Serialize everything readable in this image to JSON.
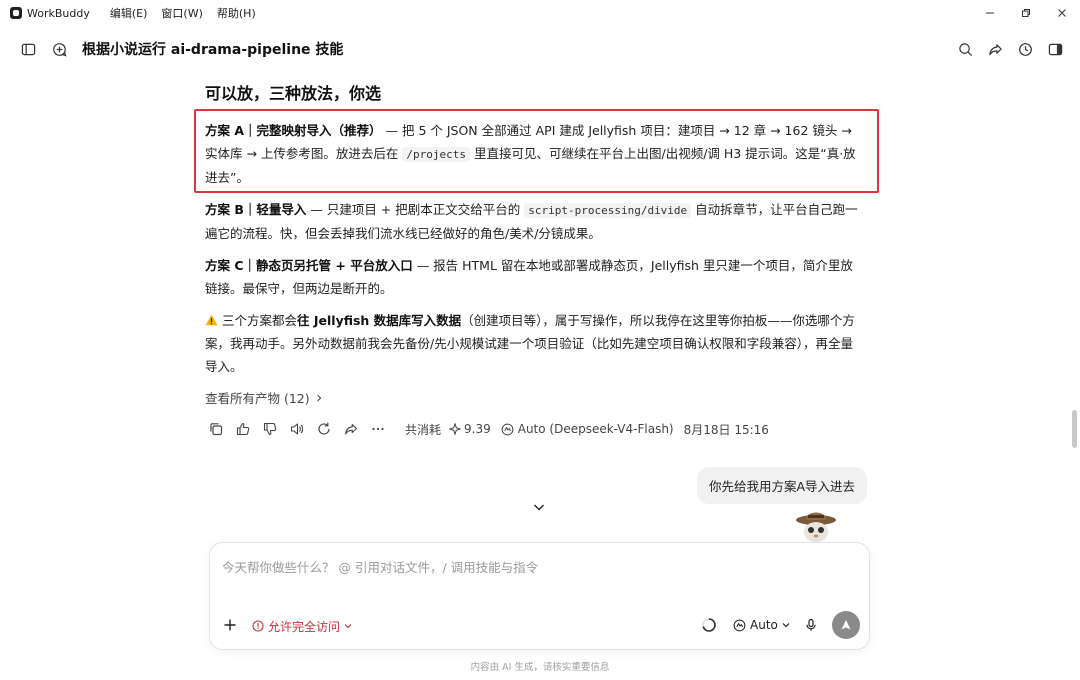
{
  "window": {
    "app_name": "WorkBuddy",
    "menus": [
      "编辑(E)",
      "窗口(W)",
      "帮助(H)"
    ]
  },
  "header": {
    "title": "根据小说运行 ai-drama-pipeline 技能"
  },
  "message": {
    "heading": "可以放，三种放法，你选",
    "option_a": {
      "label": "方案 A｜完整映射导入（推荐）",
      "text1": " — 把 5 个 JSON 全部通过 API 建成 Jellyfish 项目：建项目 → 12 章 → 162 镜头 → 实体库 → 上传参考图。放进去后在 ",
      "code": "/projects",
      "text2": " 里直接可见、可继续在平台上出图/出视频/调 H3 提示词。这是“真·放进去”。"
    },
    "option_b": {
      "label": "方案 B｜轻量导入",
      "text1": " — 只建项目 + 把剧本正文交给平台的 ",
      "code": "script-processing/divide",
      "text2": " 自动拆章节，让平台自己跑一遍它的流程。快，但会丢掉我们流水线已经做好的角色/美术/分镜成果。"
    },
    "option_c": {
      "label": "方案 C｜静态页另托管 + 平台放入口",
      "text1": " — 报告 HTML 留在本地或部署成静态页，Jellyfish 里只建一个项目，简介里放链接。最保守，但两边是断开的。"
    },
    "warning": {
      "text1": "三个方案都会",
      "bold": "往 Jellyfish 数据库写入数据",
      "text2": "（创建项目等），属于写操作，所以我停在这里等你拍板——你选哪个方案，我再动手。另外动数据前我会先备份/先小规模试建一个项目验证（比如先建空项目确认权限和字段兼容），再全量导入。"
    },
    "artifacts_link": "查看所有产物 (12)",
    "meta": {
      "cost_label": "共消耗",
      "cost_value": "9.39",
      "model": "Auto (Deepseek-V4-Flash)",
      "timestamp": "8月18日 15:16"
    }
  },
  "user_message": "你先给我用方案A导入进去",
  "input": {
    "placeholder": "今天帮你做些什么？ @ 引用对话文件，/ 调用技能与指令",
    "value": "",
    "access_label": "允许完全访问",
    "model_label": "Auto"
  },
  "footer": {
    "disclaimer": "内容由 AI 生成，请核实重要信息"
  },
  "colors": {
    "highlight": "#d9363e",
    "access": "#c4323a",
    "send": "#8a8a8a"
  }
}
